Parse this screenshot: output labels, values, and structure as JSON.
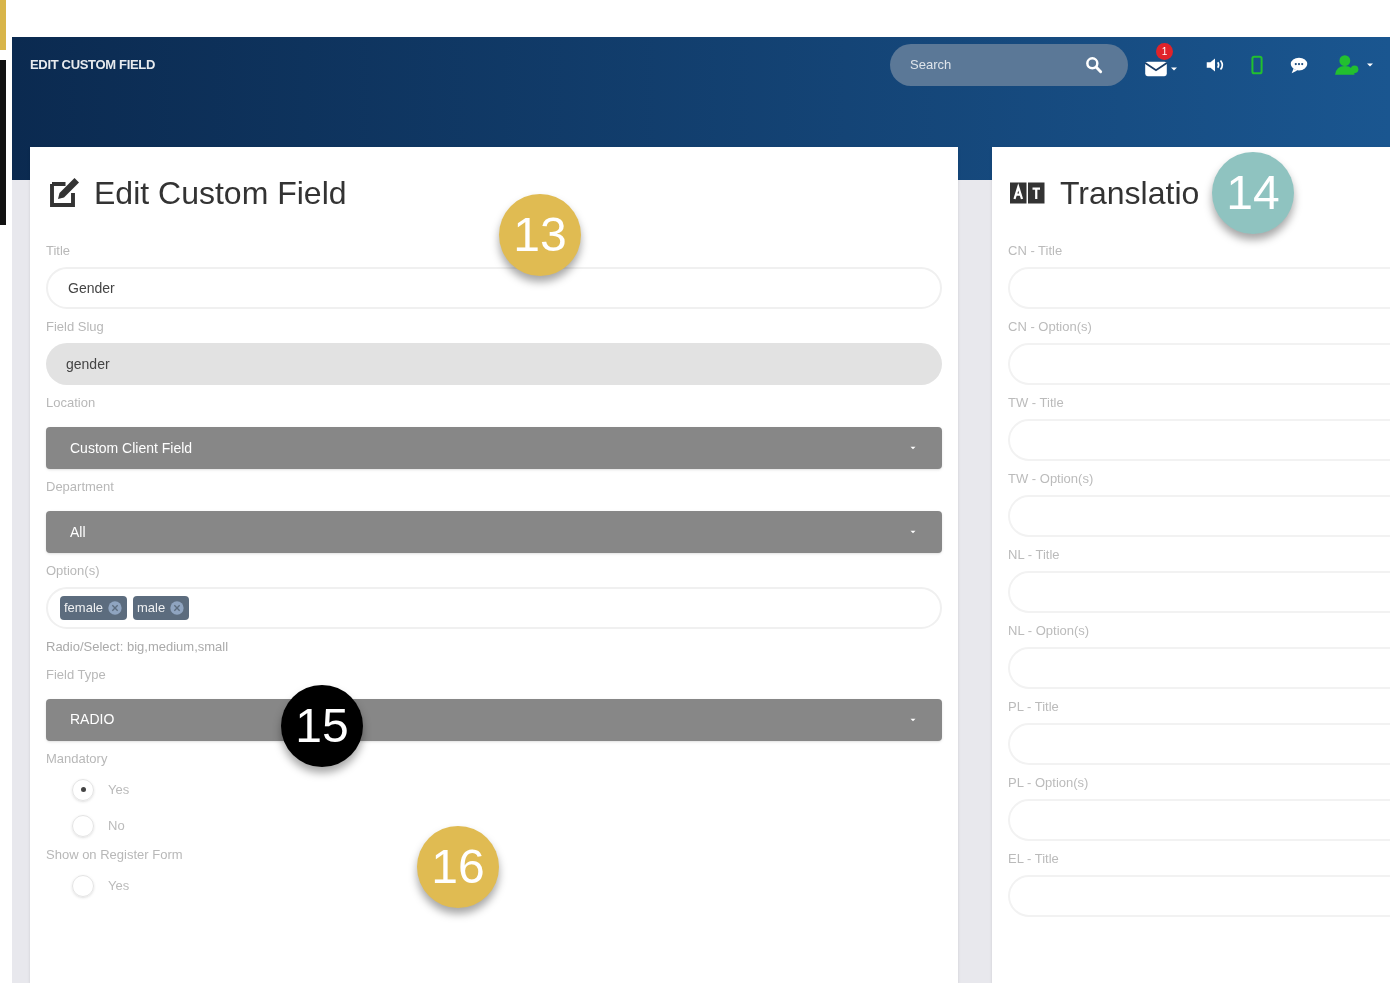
{
  "header": {
    "title": "EDIT CUSTOM FIELD",
    "search": {
      "placeholder": "Search"
    },
    "notification_count": "1"
  },
  "edit_card": {
    "title": "Edit Custom Field",
    "fields": [
      {
        "kind": "text",
        "label": "Title",
        "value": "Gender"
      },
      {
        "kind": "readonly",
        "label": "Field Slug",
        "value": "gender"
      },
      {
        "kind": "select",
        "label": "Location",
        "value": "Custom Client Field"
      },
      {
        "kind": "select",
        "label": "Department",
        "value": "All"
      },
      {
        "kind": "tags",
        "label": "Option(s)",
        "tags": [
          "female",
          "male"
        ],
        "hint": "Radio/Select: big,medium,small"
      },
      {
        "kind": "select",
        "label": "Field Type",
        "value": "RADIO"
      },
      {
        "kind": "radio",
        "label": "Mandatory",
        "options": [
          {
            "label": "Yes",
            "selected": true
          },
          {
            "label": "No",
            "selected": false
          }
        ]
      },
      {
        "kind": "radio",
        "label": "Show on Register Form",
        "options": [
          {
            "label": "Yes",
            "selected": false
          }
        ]
      }
    ]
  },
  "translation_card": {
    "title": "Translatio",
    "fields": [
      "CN - Title",
      "CN - Option(s)",
      "TW - Title",
      "TW - Option(s)",
      "NL - Title",
      "NL - Option(s)",
      "PL - Title",
      "PL - Option(s)",
      "EL - Title"
    ]
  },
  "callouts": [
    {
      "text": "13",
      "color": "#e0bb52"
    },
    {
      "text": "14",
      "color": "#8fc3c0"
    },
    {
      "text": "15",
      "color": "#000000"
    },
    {
      "text": "16",
      "color": "#e0bb52"
    }
  ]
}
